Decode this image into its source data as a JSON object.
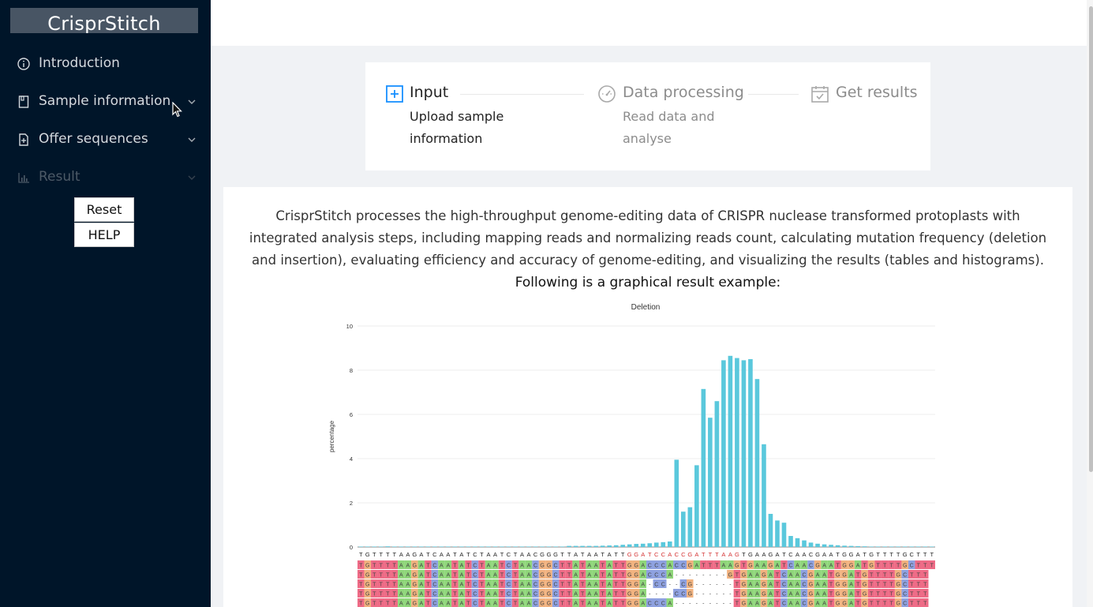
{
  "app": {
    "logo": "CrisprStitch"
  },
  "sidebar": {
    "items": [
      {
        "label": "Introduction",
        "icon": "info-circle-icon",
        "expandable": false,
        "disabled": false
      },
      {
        "label": "Sample information",
        "icon": "book-icon",
        "expandable": true,
        "disabled": false
      },
      {
        "label": "Offer sequences",
        "icon": "file-add-icon",
        "expandable": true,
        "disabled": false
      },
      {
        "label": "Result",
        "icon": "bar-chart-icon",
        "expandable": true,
        "disabled": true
      }
    ],
    "buttons": {
      "reset": "Reset",
      "help": "HELP"
    }
  },
  "steps": [
    {
      "title": "Input",
      "description": "Upload sample information",
      "state": "active",
      "icon": "plus-square-icon"
    },
    {
      "title": "Data processing",
      "description": "Read data and analyse",
      "state": "waiting",
      "icon": "dashboard-icon"
    },
    {
      "title": "Get results",
      "description": "",
      "state": "waiting",
      "icon": "calendar-check-icon"
    }
  ],
  "intro": {
    "text": "CrisprStitch processes the high-throughput genome-editing data of CRISPR nuclease transformed protoplasts with integrated analysis steps, including mapping reads and normalizing reads count, calculating mutation frequency (deletion and insertion), evaluating efficiency and accuracy of genome-editing, and visualizing the results (tables and histograms).",
    "example_label": "Following is a graphical result example:"
  },
  "colors": {
    "sidebar": "#001529",
    "accent": "#1890ff",
    "bar": "#5ac8dc"
  },
  "chart_data": {
    "type": "bar",
    "title": "Deletion",
    "ylabel": "percentage",
    "xlabel": "",
    "ylim": [
      0,
      10
    ],
    "yticks": [
      0,
      2,
      4,
      6,
      8,
      10
    ],
    "grid": true,
    "categories": [
      "T",
      "G",
      "T",
      "T",
      "T",
      "T",
      "A",
      "A",
      "G",
      "A",
      "T",
      "C",
      "A",
      "A",
      "T",
      "A",
      "T",
      "C",
      "T",
      "A",
      "A",
      "T",
      "C",
      "T",
      "A",
      "A",
      "C",
      "G",
      "G",
      "G",
      "T",
      "T",
      "A",
      "T",
      "A",
      "A",
      "T",
      "A",
      "T",
      "T",
      "G",
      "G",
      "A",
      "T",
      "C",
      "C",
      "A",
      "C",
      "C",
      "G",
      "A",
      "T",
      "T",
      "T",
      "A",
      "A",
      "G",
      "T",
      "G",
      "A",
      "A",
      "G",
      "A",
      "T",
      "C",
      "A",
      "A",
      "C",
      "G",
      "A",
      "A",
      "T",
      "G",
      "G",
      "A",
      "T",
      "G",
      "T",
      "T",
      "T",
      "T",
      "G",
      "C",
      "T",
      "T",
      "T"
    ],
    "values": [
      0.02,
      0.02,
      0.02,
      0.02,
      0.03,
      0.02,
      0.02,
      0.02,
      0.02,
      0.02,
      0.02,
      0.02,
      0.02,
      0.02,
      0.02,
      0.02,
      0.02,
      0.02,
      0.02,
      0.02,
      0.02,
      0.02,
      0.02,
      0.02,
      0.02,
      0.02,
      0.02,
      0.02,
      0.02,
      0.02,
      0.02,
      0.05,
      0.05,
      0.05,
      0.05,
      0.05,
      0.06,
      0.07,
      0.08,
      0.1,
      0.12,
      0.14,
      0.15,
      0.17,
      0.2,
      0.22,
      0.25,
      3.95,
      1.6,
      1.8,
      3.7,
      7.15,
      5.85,
      6.6,
      8.45,
      8.65,
      8.55,
      8.45,
      8.5,
      7.6,
      4.65,
      1.5,
      1.2,
      1.1,
      0.5,
      0.4,
      0.3,
      0.2,
      0.15,
      0.12,
      0.1,
      0.08,
      0.06,
      0.05,
      0.04,
      0.03,
      0.02,
      0.02,
      0.02,
      0.02,
      0.02,
      0.02,
      0.02,
      0.02,
      0.02,
      0.02
    ],
    "alignment_rows": [
      "TGTTTTAAGATCAATATCTAATCTAACGGCTTATAATATTGGACCCACCGATTTAAGTGAAGATCAACGAATGGATGTTTTGCTTT",
      "TGTTTTAAGATCAATATCTAATCTAACGGCTTATAATATTGGACCCA--------GTGAAGATCAACGAATGGATGTTTTGCTTT",
      "TGTTTTAAGATCAATATCTAATCTAACGGCTTATAATATTGGA-CC--CG------TGAAGATCAACGAATGGATGTTTTGCTTT",
      "TGTTTTAAGATCAATATCTAATCTAACGGCTTATAATATTGGA----CCG------TGAAGATCAACGAATGGATGTTTTGCTTT",
      "TGTTTTAAGATCAATATCTAATCTAACGGCTTATAATATTGGACCCA---------TGAAGATCAACGAATGGATGTTTTGCTTT"
    ]
  }
}
